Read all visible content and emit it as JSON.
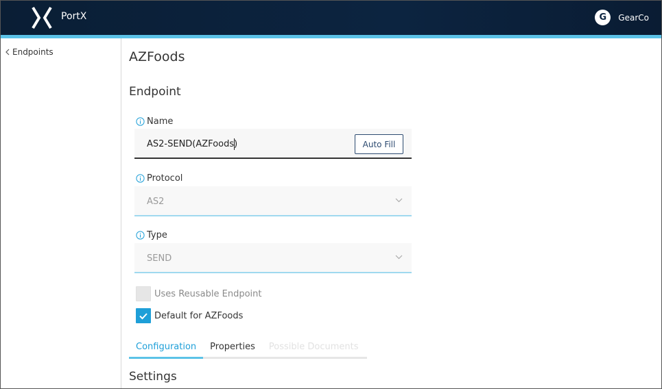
{
  "header": {
    "brand": "PortX",
    "account_initial": "G",
    "account_name": "GearCo",
    "logo_icon": "portx-logo-icon"
  },
  "sidebar": {
    "back_label": "Endpoints"
  },
  "main": {
    "title": "AZFoods",
    "section": "Endpoint",
    "fields": {
      "name": {
        "label": "Name",
        "value": "AS2-SEND(AZFoods)",
        "button": "Auto Fill"
      },
      "protocol": {
        "label": "Protocol",
        "value": "AS2"
      },
      "type": {
        "label": "Type",
        "value": "SEND"
      }
    },
    "checkboxes": {
      "reusable": {
        "label": "Uses Reusable Endpoint",
        "checked": false
      },
      "default": {
        "label": "Default for AZFoods",
        "checked": true
      }
    },
    "tabs": [
      {
        "label": "Configuration",
        "state": "active"
      },
      {
        "label": "Properties",
        "state": "normal"
      },
      {
        "label": "Possible Documents",
        "state": "disabled"
      }
    ],
    "settings_title": "Settings"
  },
  "colors": {
    "header_bg": "#0c2440",
    "accent": "#5bc2e7",
    "checkbox_on": "#1e9fd8",
    "button_border": "#2c4a70"
  }
}
